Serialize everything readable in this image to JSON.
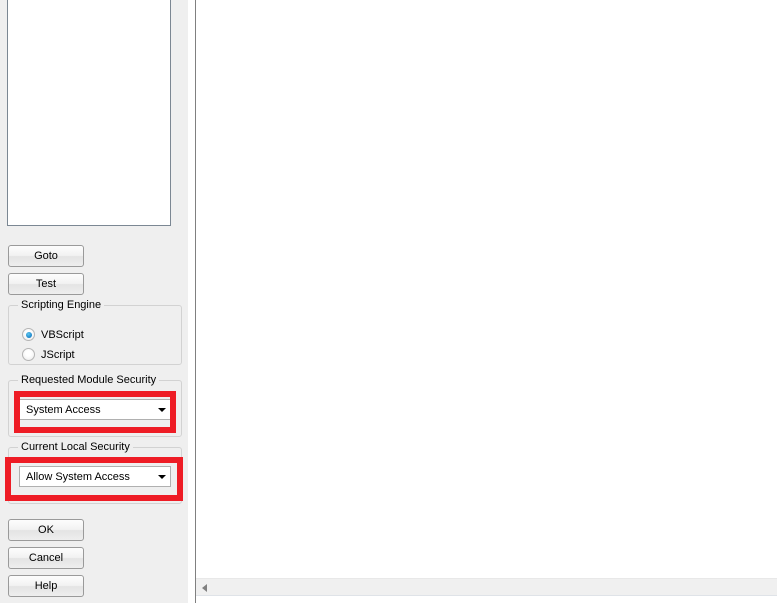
{
  "left_panel": {
    "script_box": {
      "name": "script-editor",
      "value": "",
      "placeholder": ""
    },
    "buttons": {
      "goto": "Goto",
      "test": "Test",
      "ok": "OK",
      "cancel": "Cancel",
      "help": "Help"
    },
    "scripting_engine": {
      "legend": "Scripting Engine",
      "options": [
        {
          "label": "VBScript",
          "selected": true
        },
        {
          "label": "JScript",
          "selected": false
        }
      ]
    },
    "requested_module_security": {
      "legend": "Requested Module Security",
      "selected": "System Access",
      "highlighted": true
    },
    "current_local_security": {
      "legend": "Current Local Security",
      "selected": "Allow System Access",
      "highlighted": true
    }
  },
  "right_panel": {
    "content": "",
    "scrollbar": {
      "left_arrow_icon": "triangle-left-icon"
    }
  },
  "colors": {
    "highlight": "#ee1c25",
    "panel_background": "#efefef",
    "canvas_background": "#ffffff",
    "radio_accent": "#1b82c8"
  }
}
